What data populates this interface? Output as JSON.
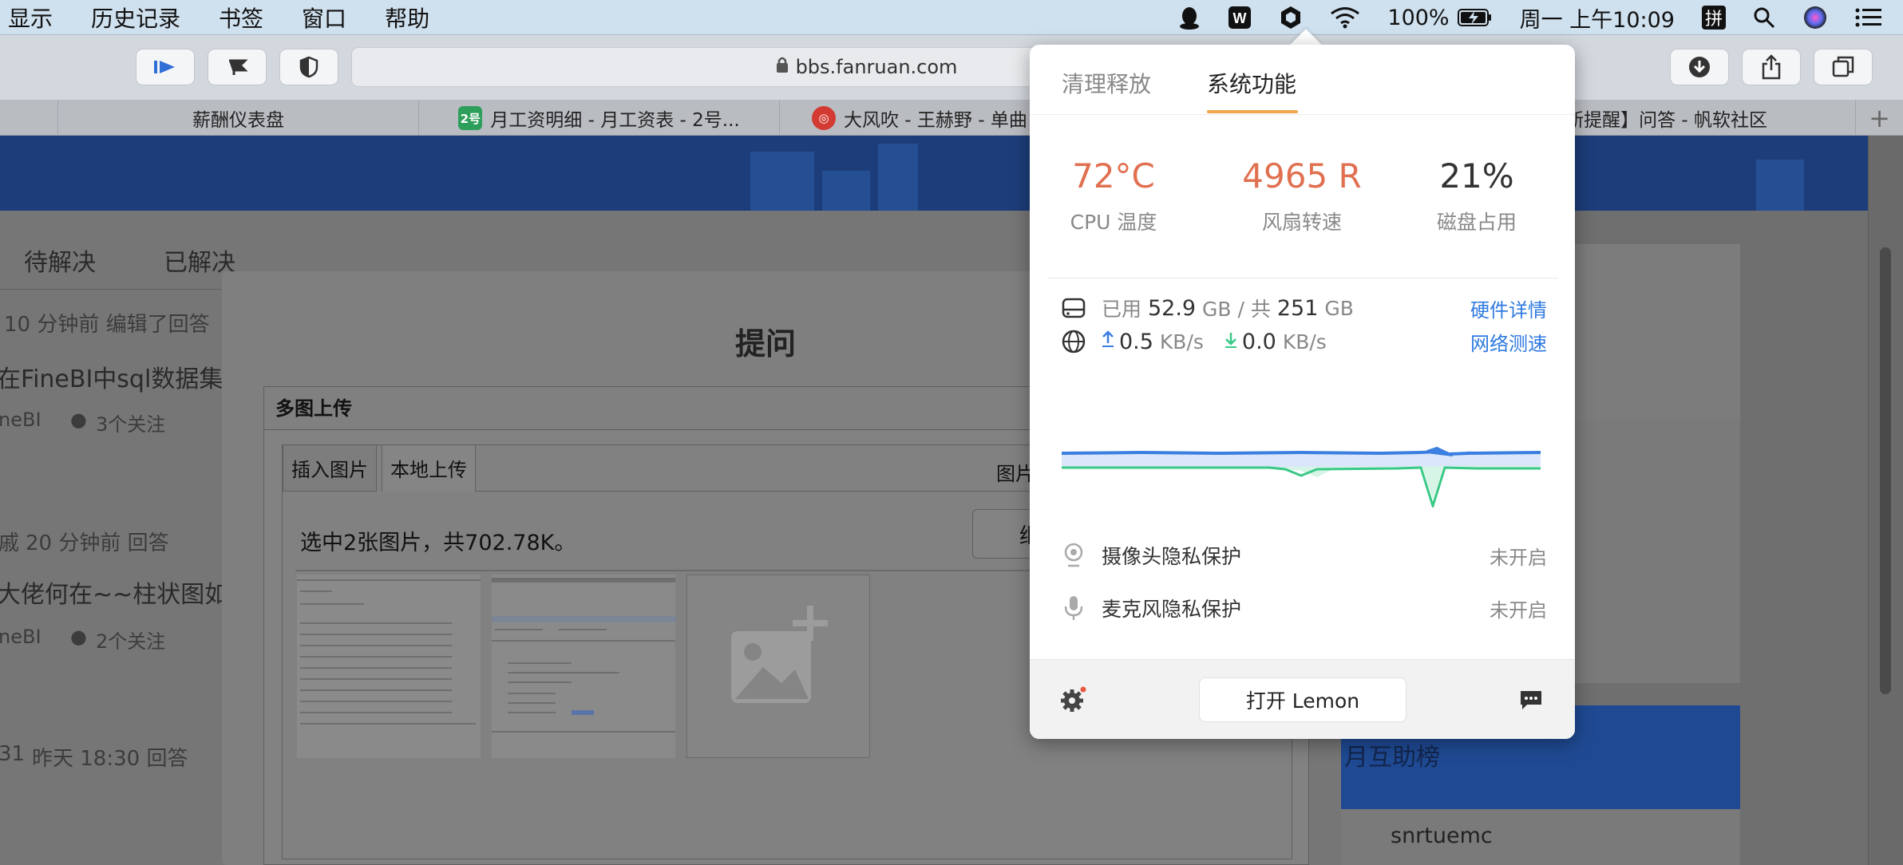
{
  "menubar": {
    "items": [
      "显示",
      "历史记录",
      "书签",
      "窗口",
      "帮助"
    ],
    "battery": "100%",
    "clock": "周一 上午10:09",
    "input_method": "拼"
  },
  "toolbar": {
    "url": "bbs.fanruan.com"
  },
  "tabs": [
    {
      "label": "薪酬仪表盘",
      "favicon": ""
    },
    {
      "label": "月工资明细 - 月工资表 - 2号...",
      "favicon": "2号"
    },
    {
      "label": "大风吹 - 王赫野 - 单曲",
      "favicon": ""
    },
    {
      "label": "【新提醒】问答 - 帆软社区",
      "favicon": ""
    }
  ],
  "page": {
    "filter_tabs": [
      "待解决",
      "已解决"
    ],
    "posts": [
      {
        "meta": "10 分钟前 编辑了回答",
        "title": "在FineBI中sql数据集",
        "tag": "neBI",
        "follow": "3个关注"
      },
      {
        "meta": "20 分钟前 回答",
        "author": "戚",
        "title": "大佬何在~~柱状图如何",
        "tag": "neBI",
        "follow": "2个关注"
      },
      {
        "meta": "昨天 18:30 回答",
        "author": "31"
      }
    ],
    "rank_title": "月互助榜",
    "rank_user": "snrtuemc"
  },
  "modal": {
    "title": "提问",
    "upload": {
      "title": "多图上传",
      "tabs": [
        "插入图片",
        "本地上传"
      ],
      "right_label": "图片",
      "info": "选中2张图片，共702.78K。",
      "continue_btn": "继续"
    }
  },
  "lemon": {
    "tabs": [
      "清理释放",
      "系统功能"
    ],
    "active_tab": 1,
    "stats": [
      {
        "value": "72°C",
        "label": "CPU 温度"
      },
      {
        "value": "4965 R",
        "label": "风扇转速"
      },
      {
        "value": "21%",
        "label": "磁盘占用"
      }
    ],
    "disk": {
      "prefix": "已用",
      "used": "52.9",
      "used_unit": "GB / 共",
      "total": "251",
      "total_unit": "GB",
      "link": "硬件详情"
    },
    "net": {
      "up": "0.5",
      "up_unit": "KB/s",
      "down": "0.0",
      "down_unit": "KB/s",
      "link": "网络测速"
    },
    "privacy": [
      {
        "label": "摄像头隐私保护",
        "state": "未开启"
      },
      {
        "label": "麦克风隐私保护",
        "state": "未开启"
      }
    ],
    "open_btn": "打开 Lemon",
    "colors": {
      "accent": "#f0a64a",
      "hot": "#e07050",
      "link": "#2f7ae0",
      "upload_line": "#3b7fe0",
      "download_line": "#39c987"
    }
  }
}
